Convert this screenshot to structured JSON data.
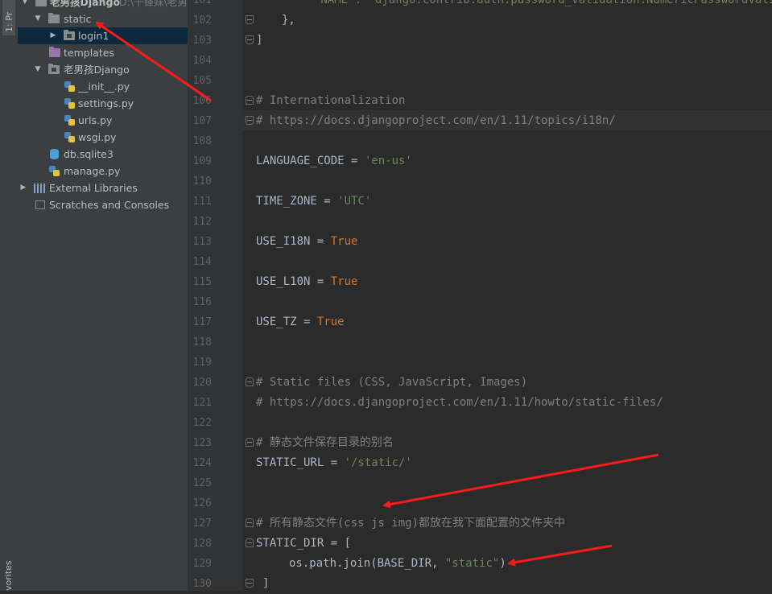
{
  "tool_window": {
    "project_tab": "1: Pr",
    "favorites_tab": "vorites"
  },
  "project_tree": {
    "root": {
      "name": "老男孩Django",
      "path": "D:\\千锋妹\\老男孩"
    },
    "static_folder": "static",
    "login1_folder": "login1",
    "templates_folder": "templates",
    "package_folder": "老男孩Django",
    "files": [
      "__init__.py",
      "settings.py",
      "urls.py",
      "wsgi.py"
    ],
    "db_file": "db.sqlite3",
    "manage_file": "manage.py",
    "external_libraries": "External Libraries",
    "scratches": "Scratches and Consoles"
  },
  "editor": {
    "line_numbers": [
      "101",
      "102",
      "103",
      "104",
      "105",
      "106",
      "107",
      "108",
      "109",
      "110",
      "111",
      "112",
      "113",
      "114",
      "115",
      "116",
      "117",
      "118",
      "119",
      "120",
      "121",
      "122",
      "123",
      "124",
      "125",
      "126",
      "127",
      "128",
      "129",
      "130"
    ],
    "lines": {
      "l101": "'NAME': 'django.contrib.auth.password_validation.NumericPasswordValidato",
      "l102": "},",
      "l103": "]",
      "l106": "# Internationalization",
      "l107": "# https://docs.djangoproject.com/en/1.11/topics/i18n/",
      "l109_key": "LANGUAGE_CODE = ",
      "l109_val": "'en-us'",
      "l111_key": "TIME_ZONE = ",
      "l111_val": "'UTC'",
      "l113_key": "USE_I18N = ",
      "l113_val": "True",
      "l115_key": "USE_L10N = ",
      "l115_val": "True",
      "l117_key": "USE_TZ = ",
      "l117_val": "True",
      "l120": "# Static files (CSS, JavaScript, Images)",
      "l121": "# https://docs.djangoproject.com/en/1.11/howto/static-files/",
      "l123": "# 静态文件保存目录的别名",
      "l124_key": "STATIC_URL = ",
      "l124_val": "'/static/'",
      "l127": "# 所有静态文件(css js img)都放在我下面配置的文件夹中",
      "l128": "STATIC_DIR = [",
      "l129_code": "os.path.join(BASE_DIR, ",
      "l129_str": "\"static\"",
      "l129_end": ")",
      "l130": "]"
    }
  },
  "annotation_color": "#ff1a1a"
}
